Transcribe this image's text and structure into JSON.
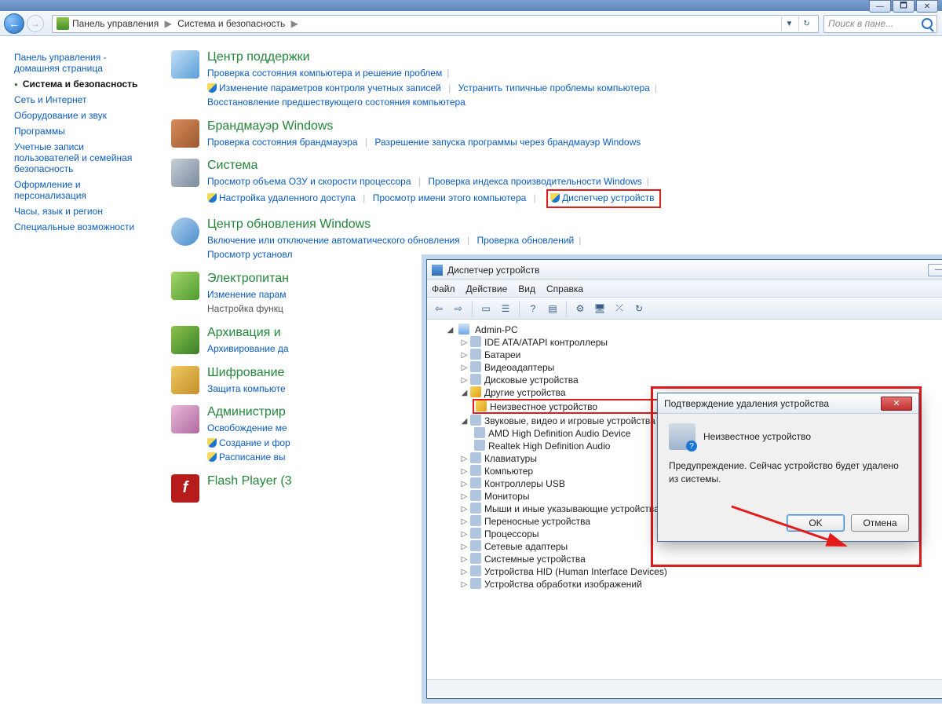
{
  "window_buttons": {
    "min": "—",
    "max": "🗖",
    "close": "✕"
  },
  "nav": {
    "back_glyph": "←",
    "fwd_glyph": "→",
    "crumbs": [
      "Панель управления",
      "Система и безопасность"
    ],
    "refresh_glyph": "↻",
    "dropdown_glyph": "▼"
  },
  "search": {
    "placeholder": "Поиск в пане..."
  },
  "sidebar": {
    "items": [
      {
        "label": "Панель управления - домашняя страница",
        "active": false
      },
      {
        "label": "Система и безопасность",
        "active": true
      },
      {
        "label": "Сеть и Интернет",
        "active": false
      },
      {
        "label": "Оборудование и звук",
        "active": false
      },
      {
        "label": "Программы",
        "active": false
      },
      {
        "label": "Учетные записи пользователей и семейная безопасность",
        "active": false
      },
      {
        "label": "Оформление и персонализация",
        "active": false
      },
      {
        "label": "Часы, язык и регион",
        "active": false
      },
      {
        "label": "Специальные возможности",
        "active": false
      }
    ]
  },
  "categories": {
    "action": {
      "title": "Центр поддержки",
      "link1": "Проверка состояния компьютера и решение проблем",
      "link2": "Изменение параметров контроля учетных записей",
      "link3": "Устранить типичные проблемы компьютера",
      "link4": "Восстановление предшествующего состояния компьютера"
    },
    "fw": {
      "title": "Брандмауэр Windows",
      "link1": "Проверка состояния брандмауэра",
      "link2": "Разрешение запуска программы через брандмауэр Windows"
    },
    "sys": {
      "title": "Система",
      "link1": "Просмотр объема ОЗУ и скорости процессора",
      "link2": "Проверка индекса производительности Windows",
      "link3": "Настройка удаленного доступа",
      "link4": "Просмотр имени этого компьютера",
      "link5": "Диспетчер устройств"
    },
    "upd": {
      "title": "Центр обновления Windows",
      "link1": "Включение или отключение автоматического обновления",
      "link2": "Проверка обновлений",
      "link3": "Просмотр установл"
    },
    "pwr": {
      "title": "Электропитан",
      "link1": "Изменение парам",
      "link2": "Настройка функц"
    },
    "arc": {
      "title": "Архивация и",
      "link1": "Архивирование да"
    },
    "enc": {
      "title": "Шифрование",
      "link1": "Защита компьюте"
    },
    "adm": {
      "title": "Администрир",
      "link1": "Освобождение ме",
      "link2": "Создание и фор",
      "link3": "Расписание вы"
    },
    "fp": {
      "title": "Flash Player (3",
      "glyph": "f"
    }
  },
  "device_manager": {
    "title": "Диспетчер устройств",
    "menu": {
      "file": "Файл",
      "action": "Действие",
      "view": "Вид",
      "help": "Справка"
    },
    "root": "Admin-PC",
    "nodes": {
      "ide": "IDE ATA/ATAPI контроллеры",
      "bat": "Батареи",
      "vid": "Видеоадаптеры",
      "disk": "Дисковые устройства",
      "other": "Другие устройства",
      "unknown": "Неизвестное устройство",
      "snd": "Звуковые, видео и игровые устройства",
      "snd1": "AMD High Definition Audio Device",
      "snd2": "Realtek High Definition Audio",
      "kbd": "Клавиатуры",
      "comp": "Компьютер",
      "usb": "Контроллеры USB",
      "mon": "Мониторы",
      "mouse": "Мыши и иные указывающие устройства",
      "port": "Переносные устройства",
      "cpu": "Процессоры",
      "net": "Сетевые адаптеры",
      "sysdev": "Системные устройства",
      "hid": "Устройства HID (Human Interface Devices)",
      "img": "Устройства обработки изображений"
    },
    "controls": {
      "min": "—",
      "max": "🗖",
      "close": "✕"
    }
  },
  "confirm": {
    "title": "Подтверждение удаления устройства",
    "device": "Неизвестное устройство",
    "warning": "Предупреждение. Сейчас устройство будет удалено из системы.",
    "ok": "OK",
    "cancel": "Отмена",
    "close_glyph": "✕"
  },
  "glyphs": {
    "tri_open": "◢",
    "tri_closed": "▷"
  }
}
